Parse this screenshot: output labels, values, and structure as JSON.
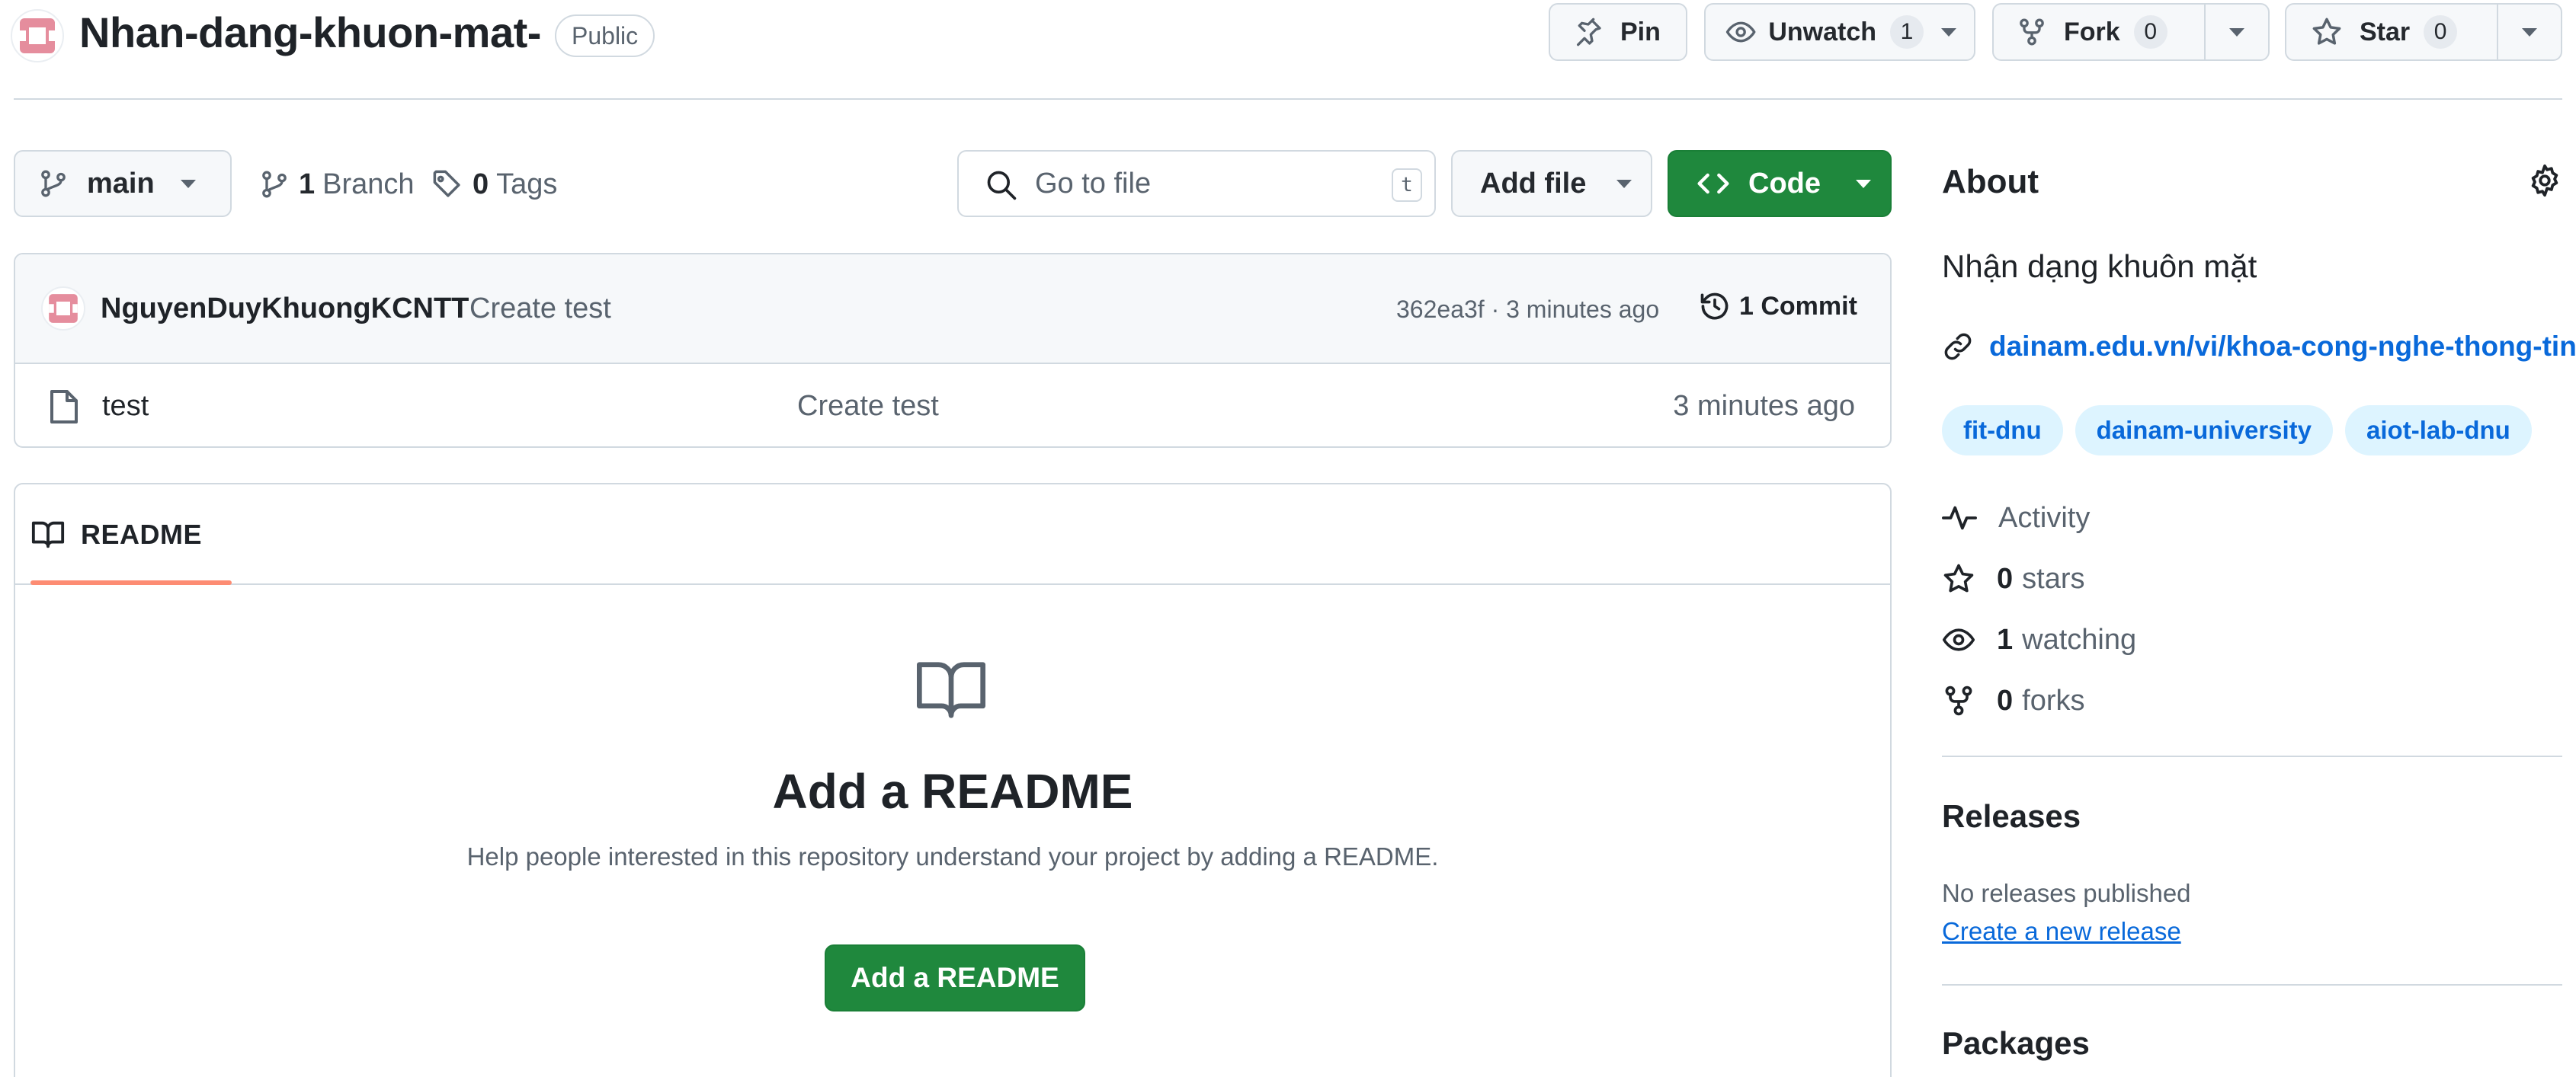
{
  "header": {
    "repo_name": "Nhan-dang-khuon-mat-",
    "visibility": "Public",
    "pin_label": "Pin",
    "unwatch_label": "Unwatch",
    "watch_count": "1",
    "fork_label": "Fork",
    "fork_count": "0",
    "star_label": "Star",
    "star_count": "0"
  },
  "toolbar": {
    "branch_name": "main",
    "branch_count": "1",
    "branch_label": "Branch",
    "tag_count": "0",
    "tag_label": "Tags",
    "search_placeholder": "Go to file",
    "search_shortcut": "t",
    "add_file_label": "Add file",
    "code_label": "Code"
  },
  "latest_commit": {
    "author": "NguyenDuyKhuongKCNTT",
    "message": "Create test",
    "meta": "362ea3f · 3 minutes ago",
    "commit_count_label": "1 Commit"
  },
  "files": [
    {
      "name": "test",
      "commit_message": "Create test",
      "time": "3 minutes ago"
    }
  ],
  "readme": {
    "tab_label": "README",
    "empty_title": "Add a README",
    "empty_description": "Help people interested in this repository understand your project by adding a README.",
    "add_button_label": "Add a README"
  },
  "about": {
    "heading": "About",
    "description": "Nhận dạng khuôn mặt",
    "website": "dainam.edu.vn/vi/khoa-cong-nghe-thong-tin",
    "topics": [
      "fit-dnu",
      "dainam-university",
      "aiot-lab-dnu"
    ],
    "activity_label": "Activity",
    "stars_count": "0",
    "stars_label": "stars",
    "watching_count": "1",
    "watching_label": "watching",
    "forks_count": "0",
    "forks_label": "forks"
  },
  "releases": {
    "heading": "Releases",
    "empty_text": "No releases published",
    "create_link": "Create a new release"
  },
  "packages": {
    "heading": "Packages"
  },
  "colors": {
    "primary_green": "#1f883d",
    "link_blue": "#0969da",
    "topic_bg": "#ddf4ff",
    "tab_underline": "#fd8c73"
  }
}
